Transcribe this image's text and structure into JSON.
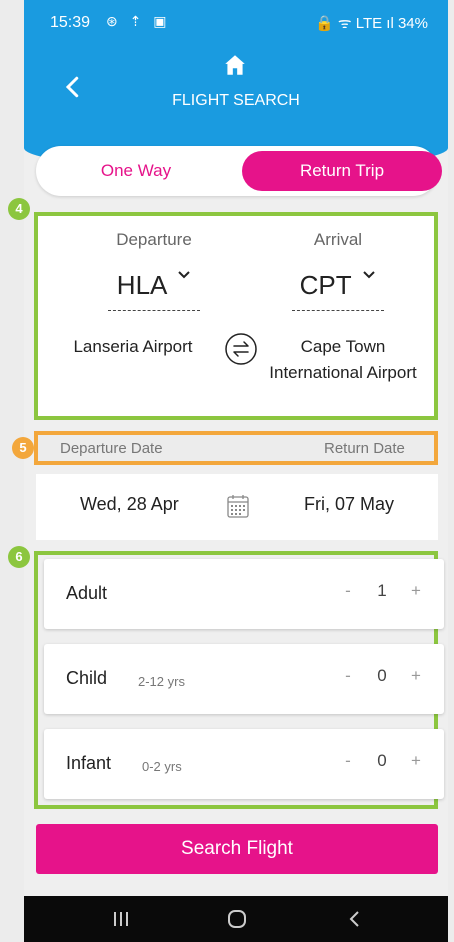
{
  "status_bar": {
    "time": "15:39",
    "left_icons": "⊛ ⇡ ▣",
    "right_text": "🔒 ᯤ LTE ıl 34%"
  },
  "header": {
    "title": "FLIGHT SEARCH"
  },
  "trip_toggle": {
    "one_way": "One Way",
    "return_trip": "Return Trip",
    "selected": "Return Trip"
  },
  "badges": {
    "route": "4",
    "dates": "5",
    "passengers": "6"
  },
  "route": {
    "departure_label": "Departure",
    "arrival_label": "Arrival",
    "departure_code": "HLA",
    "arrival_code": "CPT",
    "departure_airport": "Lanseria Airport",
    "arrival_airport": "Cape Town International Airport"
  },
  "dates": {
    "departure_label": "Departure Date",
    "return_label": "Return Date",
    "departure_value": "Wed, 28 Apr",
    "return_value": "Fri, 07 May"
  },
  "passengers": [
    {
      "name": "Adult",
      "age": "",
      "count": "1"
    },
    {
      "name": "Child",
      "age": "2-12 yrs",
      "count": "0"
    },
    {
      "name": "Infant",
      "age": "0-2 yrs",
      "count": "0"
    }
  ],
  "stepper": {
    "minus": "-",
    "plus": "+"
  },
  "search_button": "Search Flight",
  "colors": {
    "header": "#1a9be0",
    "accent": "#e6138a",
    "green_outline": "#8cc63f",
    "orange_outline": "#f3a73c"
  },
  "icons": {
    "home": "home-icon",
    "back": "back-icon",
    "swap": "swap-icon",
    "calendar": "calendar-icon",
    "dropdown": "chevron-down-icon"
  }
}
